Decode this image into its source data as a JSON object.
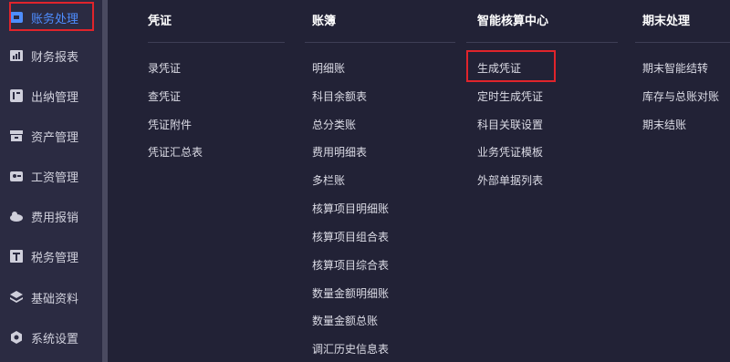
{
  "sidebar": {
    "items": [
      {
        "label": "账务处理",
        "icon": "ledger-icon",
        "active": true
      },
      {
        "label": "财务报表",
        "icon": "report-icon",
        "active": false
      },
      {
        "label": "出纳管理",
        "icon": "cashier-icon",
        "active": false
      },
      {
        "label": "资产管理",
        "icon": "asset-icon",
        "active": false
      },
      {
        "label": "工资管理",
        "icon": "salary-icon",
        "active": false
      },
      {
        "label": "费用报销",
        "icon": "expense-icon",
        "active": false
      },
      {
        "label": "税务管理",
        "icon": "tax-icon",
        "active": false
      },
      {
        "label": "基础资料",
        "icon": "layers-icon",
        "active": false
      },
      {
        "label": "系统设置",
        "icon": "settings-icon",
        "active": false
      }
    ]
  },
  "menu": {
    "columns": [
      {
        "title": "凭证",
        "items": [
          "录凭证",
          "查凭证",
          "凭证附件",
          "凭证汇总表"
        ]
      },
      {
        "title": "账簿",
        "items": [
          "明细账",
          "科目余额表",
          "总分类账",
          "费用明细表",
          "多栏账",
          "核算项目明细账",
          "核算项目组合表",
          "核算项目综合表",
          "数量金额明细账",
          "数量金额总账",
          "调汇历史信息表"
        ]
      },
      {
        "title": "智能核算中心",
        "items": [
          "生成凭证",
          "定时生成凭证",
          "科目关联设置",
          "业务凭证模板",
          "外部单据列表"
        ]
      },
      {
        "title": "期末处理",
        "items": [
          "期末智能结转",
          "库存与总账对账",
          "期末结账"
        ]
      }
    ]
  },
  "colors": {
    "accent": "#4e8dff",
    "highlight": "#e0242b",
    "background": "#232338",
    "sidebar": "#2b2b42"
  }
}
